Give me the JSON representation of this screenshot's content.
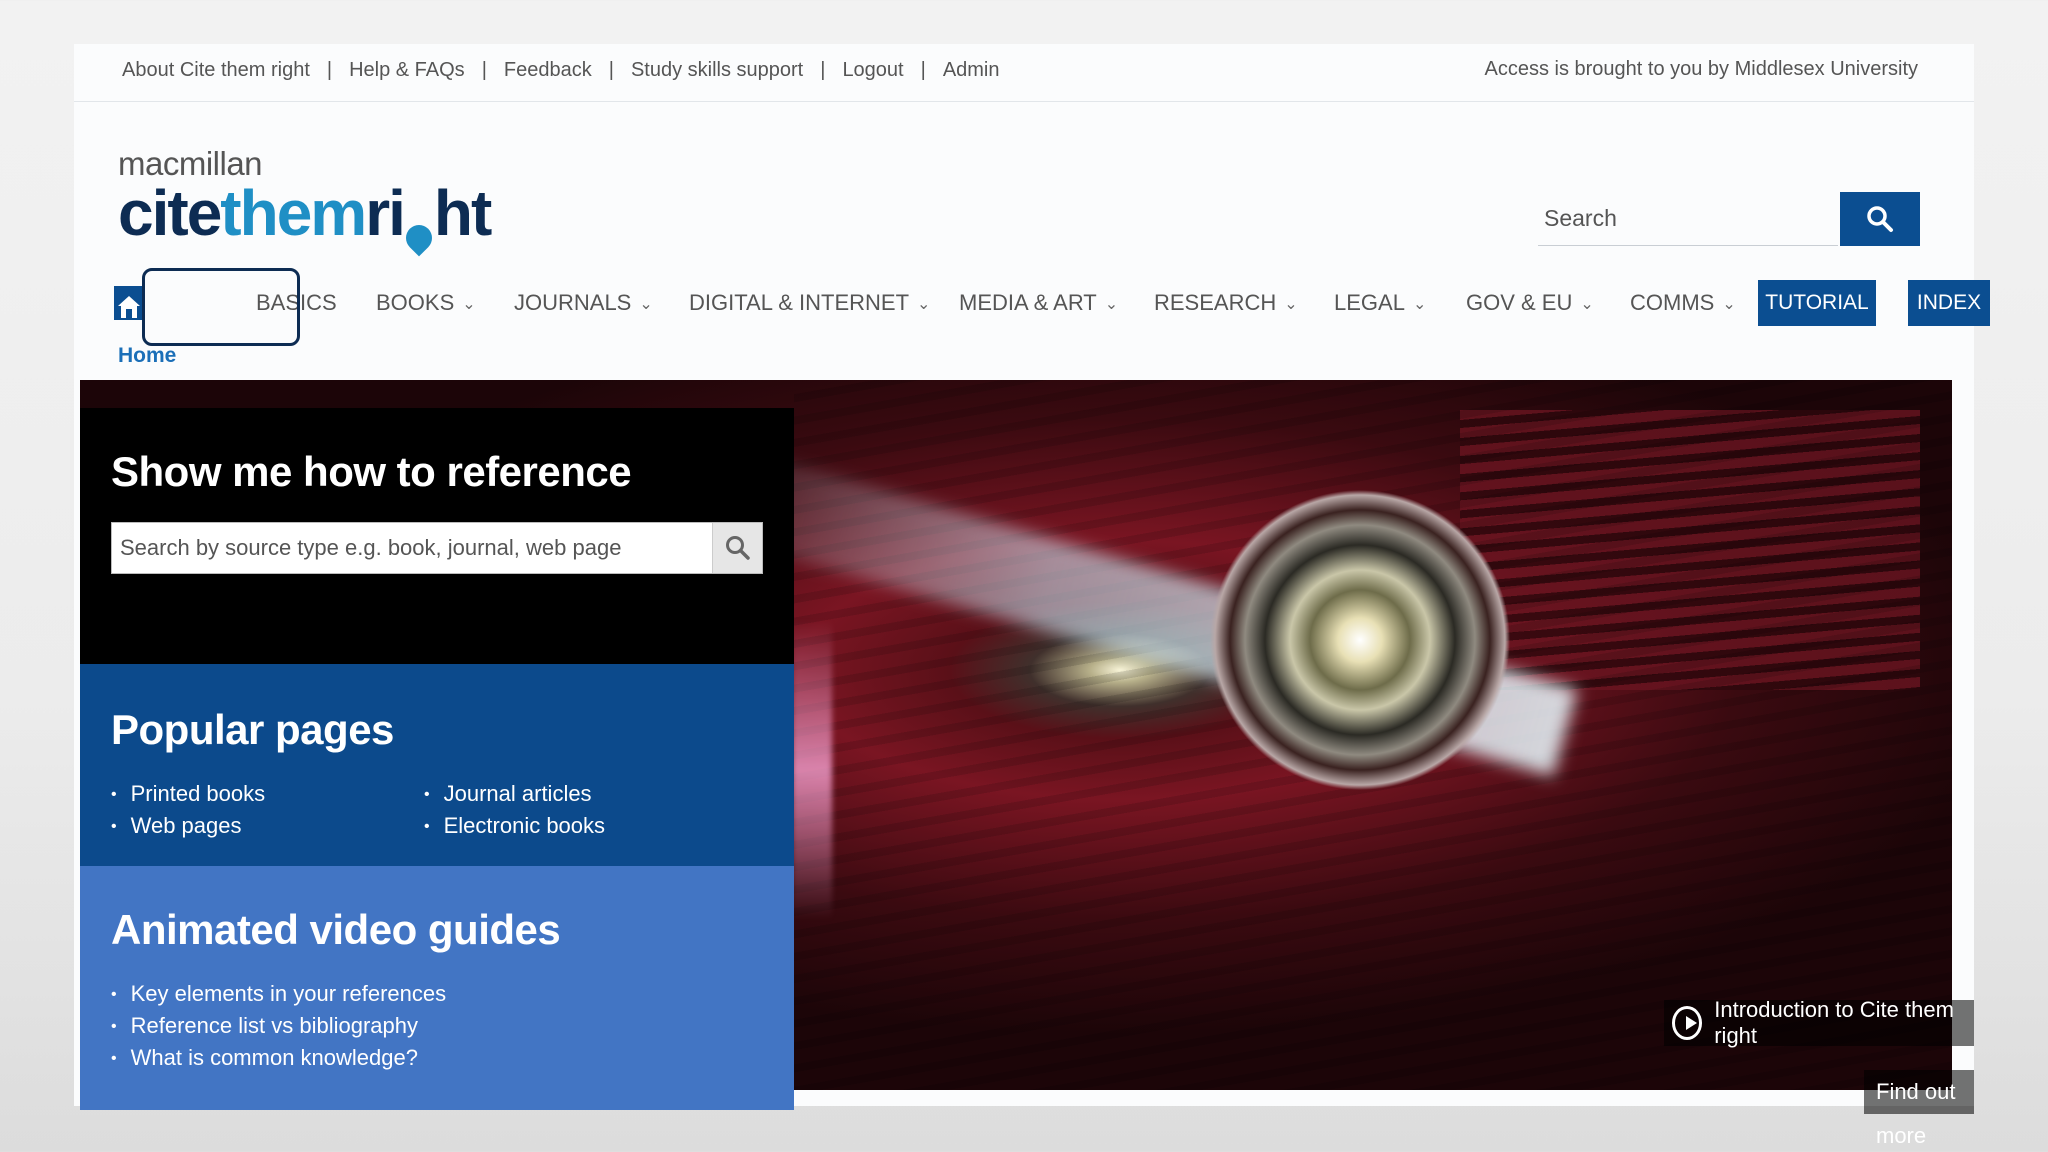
{
  "topbar": {
    "links": [
      "About Cite them right",
      "Help & FAQs",
      "Feedback",
      "Study skills support",
      "Logout",
      "Admin"
    ],
    "access_text": "Access is brought to you by Middlesex University"
  },
  "logo": {
    "publisher": "macmillan",
    "part1": "cite",
    "part2": "them",
    "part3": "ri",
    "part4": "ht"
  },
  "header_search": {
    "placeholder": "Search",
    "icon": "search-icon"
  },
  "nav": {
    "home_icon": "home-icon",
    "items": [
      {
        "label": "BASICS",
        "dropdown": false
      },
      {
        "label": "BOOKS",
        "dropdown": true
      },
      {
        "label": "JOURNALS",
        "dropdown": true
      },
      {
        "label": "DIGITAL & INTERNET",
        "dropdown": true
      },
      {
        "label": "MEDIA & ART",
        "dropdown": true
      },
      {
        "label": "RESEARCH",
        "dropdown": true
      },
      {
        "label": "LEGAL",
        "dropdown": true
      },
      {
        "label": "GOV & EU",
        "dropdown": true
      },
      {
        "label": "COMMS",
        "dropdown": true
      }
    ],
    "tutorial_label": "TUTORIAL",
    "index_label": "INDEX",
    "chevron": "⌄"
  },
  "breadcrumb": "Home",
  "reference_panel": {
    "title": "Show me how to reference",
    "search_placeholder": "Search by source type e.g. book, journal, web page"
  },
  "popular": {
    "title": "Popular pages",
    "col1": [
      "Printed books",
      "Web pages"
    ],
    "col2": [
      "Journal articles",
      "Electronic books"
    ]
  },
  "video": {
    "title": "Animated video guides",
    "items": [
      "Key elements in your references",
      "Reference list vs bibliography",
      "What is common knowledge?"
    ]
  },
  "hero": {
    "intro_label": "Introduction to Cite them right",
    "find_more": "Find out more"
  },
  "colors": {
    "brand_dark": "#0d2c53",
    "brand_light": "#1f8fc5",
    "nav_button": "#0b4e91",
    "popular_bg": "#0c4a8c",
    "video_bg": "#4275c4"
  }
}
